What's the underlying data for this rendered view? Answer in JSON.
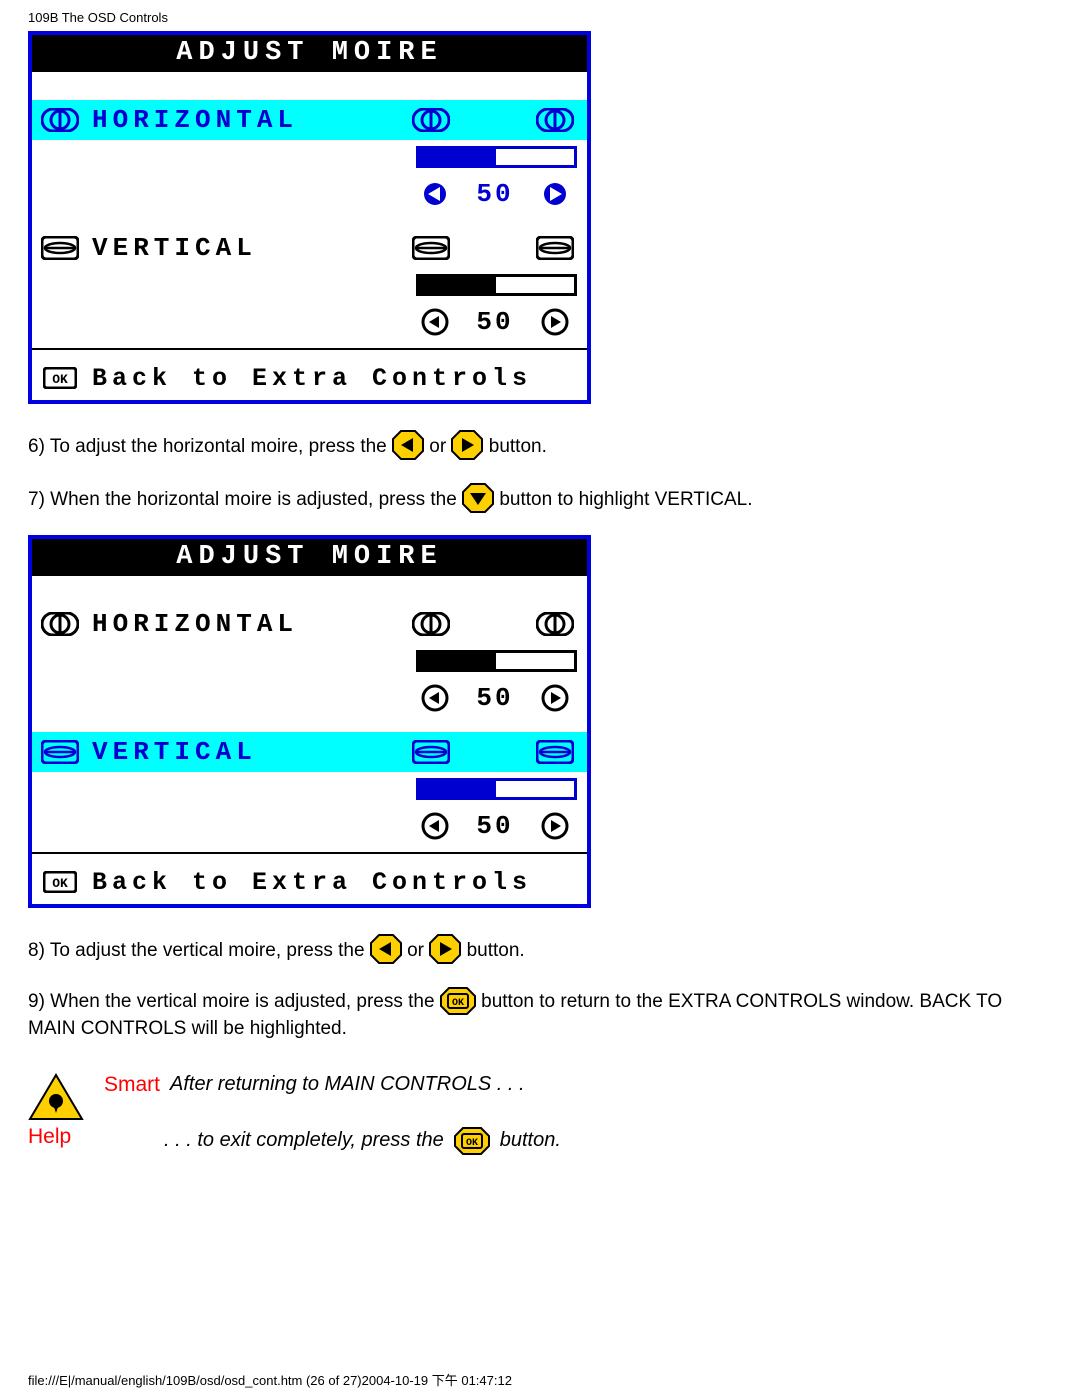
{
  "page_header": "109B The OSD Controls",
  "osd_title": "Adjust Moire",
  "screen1": {
    "horizontal": {
      "label": "Horizontal",
      "value": "50",
      "selected": true,
      "fill_pct": 50
    },
    "vertical": {
      "label": "Vertical",
      "value": "50",
      "selected": false,
      "fill_pct": 50
    }
  },
  "screen2": {
    "horizontal": {
      "label": "Horizontal",
      "value": "50",
      "selected": false,
      "fill_pct": 50
    },
    "vertical": {
      "label": "Vertical",
      "value": "50",
      "selected": true,
      "fill_pct": 50
    }
  },
  "back_label": "Back to Extra Controls",
  "step6_a": "6) To adjust the horizontal moire, press the ",
  "step6_b": " or",
  "step6_c": " button.",
  "step7_a": "7) When the horizontal moire is adjusted, press the ",
  "step7_b": " button to highlight VERTICAL.",
  "step8_a": "8) To adjust the vertical moire, press the ",
  "step8_b": " or",
  "step8_c": " button.",
  "step9_a": "9) When the vertical moire is adjusted, press the ",
  "step9_b": " button to return to the EXTRA CONTROLS window. BACK TO MAIN CONTROLS will be highlighted.",
  "smart_label_1": "Smart",
  "smart_label_2": "Help",
  "smart_hint_1": "After returning to MAIN CONTROLS . . .",
  "smart_hint_2a": ". . . to exit completely, press the ",
  "smart_hint_2b": " button.",
  "footer": "file:///E|/manual/english/109B/osd/osd_cont.htm (26 of 27)2004-10-19 下午 01:47:12"
}
